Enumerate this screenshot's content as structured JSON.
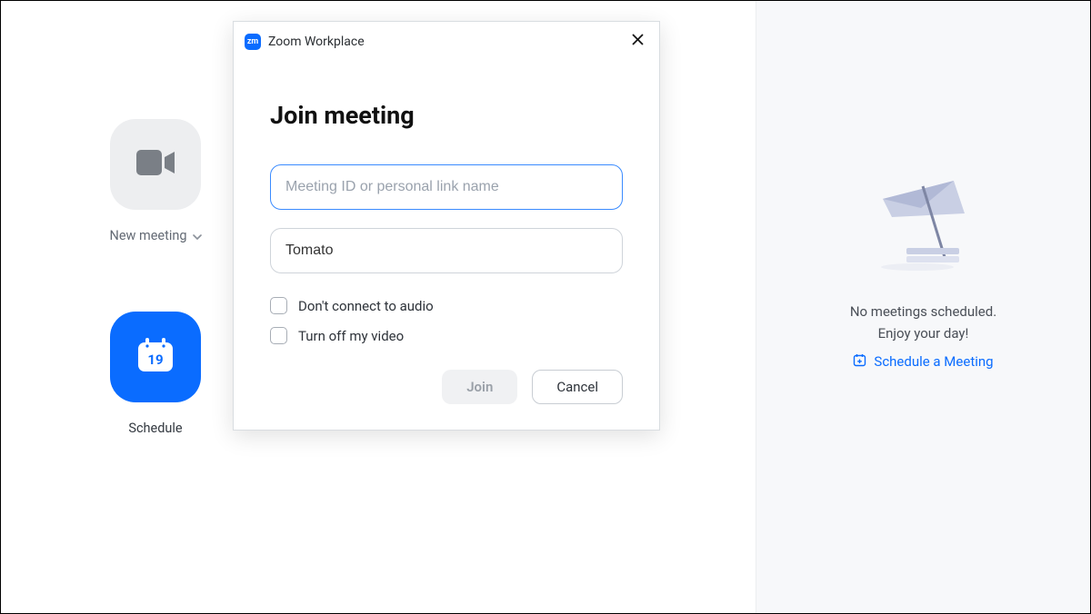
{
  "tiles": {
    "new_meeting": {
      "label": "New meeting"
    },
    "schedule": {
      "label": "Schedule",
      "day_number": "19"
    }
  },
  "right_panel": {
    "line1": "No meetings scheduled.",
    "line2": "Enjoy your day!",
    "schedule_link": "Schedule a Meeting"
  },
  "modal": {
    "app_badge_text": "zm",
    "app_title": "Zoom Workplace",
    "heading": "Join meeting",
    "meeting_id_placeholder": "Meeting ID or personal link name",
    "name_value": "Tomato",
    "checkbox_audio": "Don't connect to audio",
    "checkbox_video": "Turn off my video",
    "join_button": "Join",
    "cancel_button": "Cancel"
  }
}
